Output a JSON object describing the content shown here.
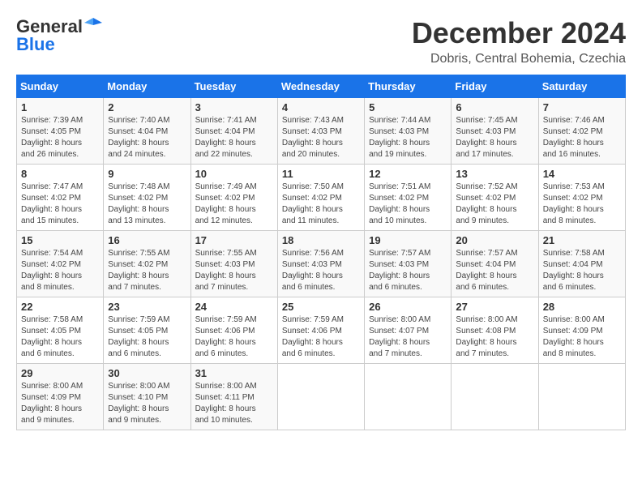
{
  "logo": {
    "line1": "General",
    "line2": "Blue"
  },
  "title": "December 2024",
  "subtitle": "Dobris, Central Bohemia, Czechia",
  "weekdays": [
    "Sunday",
    "Monday",
    "Tuesday",
    "Wednesday",
    "Thursday",
    "Friday",
    "Saturday"
  ],
  "weeks": [
    [
      {
        "day": "1",
        "info": "Sunrise: 7:39 AM\nSunset: 4:05 PM\nDaylight: 8 hours\nand 26 minutes."
      },
      {
        "day": "2",
        "info": "Sunrise: 7:40 AM\nSunset: 4:04 PM\nDaylight: 8 hours\nand 24 minutes."
      },
      {
        "day": "3",
        "info": "Sunrise: 7:41 AM\nSunset: 4:04 PM\nDaylight: 8 hours\nand 22 minutes."
      },
      {
        "day": "4",
        "info": "Sunrise: 7:43 AM\nSunset: 4:03 PM\nDaylight: 8 hours\nand 20 minutes."
      },
      {
        "day": "5",
        "info": "Sunrise: 7:44 AM\nSunset: 4:03 PM\nDaylight: 8 hours\nand 19 minutes."
      },
      {
        "day": "6",
        "info": "Sunrise: 7:45 AM\nSunset: 4:03 PM\nDaylight: 8 hours\nand 17 minutes."
      },
      {
        "day": "7",
        "info": "Sunrise: 7:46 AM\nSunset: 4:02 PM\nDaylight: 8 hours\nand 16 minutes."
      }
    ],
    [
      {
        "day": "8",
        "info": "Sunrise: 7:47 AM\nSunset: 4:02 PM\nDaylight: 8 hours\nand 15 minutes."
      },
      {
        "day": "9",
        "info": "Sunrise: 7:48 AM\nSunset: 4:02 PM\nDaylight: 8 hours\nand 13 minutes."
      },
      {
        "day": "10",
        "info": "Sunrise: 7:49 AM\nSunset: 4:02 PM\nDaylight: 8 hours\nand 12 minutes."
      },
      {
        "day": "11",
        "info": "Sunrise: 7:50 AM\nSunset: 4:02 PM\nDaylight: 8 hours\nand 11 minutes."
      },
      {
        "day": "12",
        "info": "Sunrise: 7:51 AM\nSunset: 4:02 PM\nDaylight: 8 hours\nand 10 minutes."
      },
      {
        "day": "13",
        "info": "Sunrise: 7:52 AM\nSunset: 4:02 PM\nDaylight: 8 hours\nand 9 minutes."
      },
      {
        "day": "14",
        "info": "Sunrise: 7:53 AM\nSunset: 4:02 PM\nDaylight: 8 hours\nand 8 minutes."
      }
    ],
    [
      {
        "day": "15",
        "info": "Sunrise: 7:54 AM\nSunset: 4:02 PM\nDaylight: 8 hours\nand 8 minutes."
      },
      {
        "day": "16",
        "info": "Sunrise: 7:55 AM\nSunset: 4:02 PM\nDaylight: 8 hours\nand 7 minutes."
      },
      {
        "day": "17",
        "info": "Sunrise: 7:55 AM\nSunset: 4:03 PM\nDaylight: 8 hours\nand 7 minutes."
      },
      {
        "day": "18",
        "info": "Sunrise: 7:56 AM\nSunset: 4:03 PM\nDaylight: 8 hours\nand 6 minutes."
      },
      {
        "day": "19",
        "info": "Sunrise: 7:57 AM\nSunset: 4:03 PM\nDaylight: 8 hours\nand 6 minutes."
      },
      {
        "day": "20",
        "info": "Sunrise: 7:57 AM\nSunset: 4:04 PM\nDaylight: 8 hours\nand 6 minutes."
      },
      {
        "day": "21",
        "info": "Sunrise: 7:58 AM\nSunset: 4:04 PM\nDaylight: 8 hours\nand 6 minutes."
      }
    ],
    [
      {
        "day": "22",
        "info": "Sunrise: 7:58 AM\nSunset: 4:05 PM\nDaylight: 8 hours\nand 6 minutes."
      },
      {
        "day": "23",
        "info": "Sunrise: 7:59 AM\nSunset: 4:05 PM\nDaylight: 8 hours\nand 6 minutes."
      },
      {
        "day": "24",
        "info": "Sunrise: 7:59 AM\nSunset: 4:06 PM\nDaylight: 8 hours\nand 6 minutes."
      },
      {
        "day": "25",
        "info": "Sunrise: 7:59 AM\nSunset: 4:06 PM\nDaylight: 8 hours\nand 6 minutes."
      },
      {
        "day": "26",
        "info": "Sunrise: 8:00 AM\nSunset: 4:07 PM\nDaylight: 8 hours\nand 7 minutes."
      },
      {
        "day": "27",
        "info": "Sunrise: 8:00 AM\nSunset: 4:08 PM\nDaylight: 8 hours\nand 7 minutes."
      },
      {
        "day": "28",
        "info": "Sunrise: 8:00 AM\nSunset: 4:09 PM\nDaylight: 8 hours\nand 8 minutes."
      }
    ],
    [
      {
        "day": "29",
        "info": "Sunrise: 8:00 AM\nSunset: 4:09 PM\nDaylight: 8 hours\nand 9 minutes."
      },
      {
        "day": "30",
        "info": "Sunrise: 8:00 AM\nSunset: 4:10 PM\nDaylight: 8 hours\nand 9 minutes."
      },
      {
        "day": "31",
        "info": "Sunrise: 8:00 AM\nSunset: 4:11 PM\nDaylight: 8 hours\nand 10 minutes."
      },
      null,
      null,
      null,
      null
    ]
  ]
}
